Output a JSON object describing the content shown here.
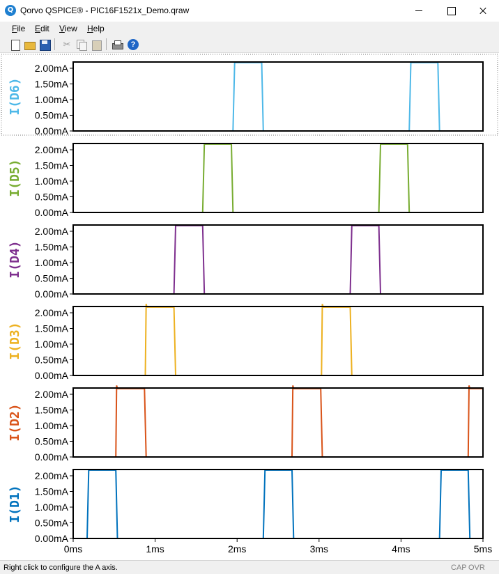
{
  "window": {
    "title": "Qorvo QSPICE® - PIC16F1521x_Demo.qraw"
  },
  "menu": {
    "file": "File",
    "edit": "Edit",
    "view": "View",
    "help": "Help"
  },
  "toolbar": {
    "icons": [
      "new-file-icon",
      "open-folder-icon",
      "save-icon",
      "cut-icon",
      "copy-icon",
      "paste-icon",
      "print-icon",
      "help-icon"
    ]
  },
  "status": {
    "text": "Right click to configure the A axis.",
    "cap": "CAP",
    "ovr": "OVR"
  },
  "chart_data": {
    "type": "line",
    "x_ticks": [
      "0ms",
      "1ms",
      "2ms",
      "3ms",
      "4ms",
      "5ms"
    ],
    "xlim": [
      0,
      5
    ],
    "x_unit": "ms",
    "ylim": [
      0,
      2.2
    ],
    "y_ticks": [
      "0.00mA",
      "0.50mA",
      "1.00mA",
      "1.50mA",
      "2.00mA"
    ],
    "y_unit": "mA",
    "grid": false,
    "series": [
      {
        "name": "I(D6)",
        "color": "#4db8e8",
        "x": [
          0,
          1.95,
          1.97,
          2.3,
          2.32,
          4.1,
          4.12,
          4.45,
          4.47,
          5.0
        ],
        "y": [
          0,
          0,
          2.18,
          2.18,
          0,
          0,
          2.18,
          2.18,
          0,
          0
        ]
      },
      {
        "name": "I(D5)",
        "color": "#77ac30",
        "x": [
          0,
          1.58,
          1.6,
          1.93,
          1.95,
          3.73,
          3.75,
          4.08,
          4.1,
          5.0
        ],
        "y": [
          0,
          0,
          2.18,
          2.18,
          0,
          0,
          2.18,
          2.18,
          0,
          0
        ]
      },
      {
        "name": "I(D4)",
        "color": "#7e2f8e",
        "x": [
          0,
          1.23,
          1.25,
          1.58,
          1.6,
          3.38,
          3.4,
          3.73,
          3.75,
          5.0
        ],
        "y": [
          0,
          0,
          2.18,
          2.18,
          0,
          0,
          2.18,
          2.18,
          0,
          0
        ]
      },
      {
        "name": "I(D3)",
        "color": "#edb120",
        "x": [
          0,
          0.88,
          0.89,
          0.9,
          1.23,
          1.25,
          3.03,
          3.04,
          3.05,
          3.38,
          3.4,
          5.0
        ],
        "y": [
          0,
          0,
          2.28,
          2.18,
          2.18,
          0,
          0,
          2.28,
          2.18,
          2.18,
          0,
          0
        ]
      },
      {
        "name": "I(D2)",
        "color": "#d95319",
        "x": [
          0,
          0.52,
          0.53,
          0.54,
          0.87,
          0.89,
          2.67,
          2.68,
          2.69,
          3.02,
          3.04,
          4.82,
          4.83,
          4.84,
          5.0
        ],
        "y": [
          0,
          0,
          2.28,
          2.18,
          2.18,
          0,
          0,
          2.28,
          2.18,
          2.18,
          0,
          0,
          2.28,
          2.18,
          2.18
        ]
      },
      {
        "name": "I(D1)",
        "color": "#0072bd",
        "x": [
          0,
          0.17,
          0.19,
          0.52,
          0.54,
          2.32,
          2.34,
          2.67,
          2.69,
          4.47,
          4.49,
          4.82,
          4.84,
          5.0
        ],
        "y": [
          0,
          0,
          2.18,
          2.18,
          0,
          0,
          2.18,
          2.18,
          0,
          0,
          2.18,
          2.18,
          0,
          0
        ]
      }
    ]
  }
}
